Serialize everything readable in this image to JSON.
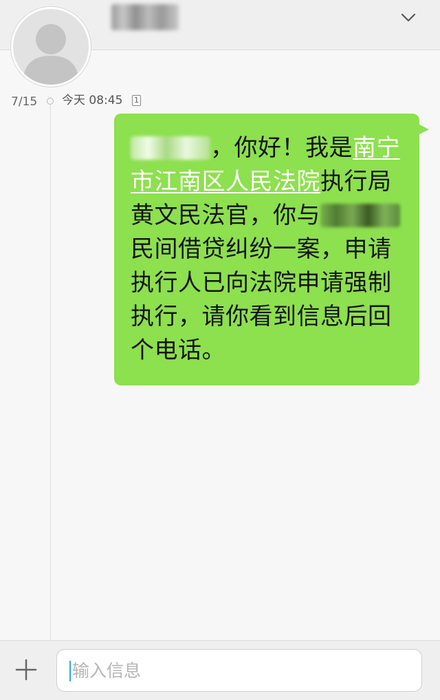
{
  "conversation": {
    "collapse_icon": "chevron-down-icon"
  },
  "timeline": {
    "date": "7/15",
    "time": "今天 08:45",
    "sim_slot": "1"
  },
  "message": {
    "greeting": "，你好！我是",
    "court_link": "南宁市江南区人民法院",
    "body_1": "执行局黄文民法官，你与",
    "body_2": "民间借贷纠纷一案，申请执行人已向法院申请强制执行，请你看到信息后回个电话。",
    "bubble_color": "#8de04e"
  },
  "composer": {
    "attach_icon": "plus-icon",
    "placeholder": "输入信息",
    "value": ""
  }
}
